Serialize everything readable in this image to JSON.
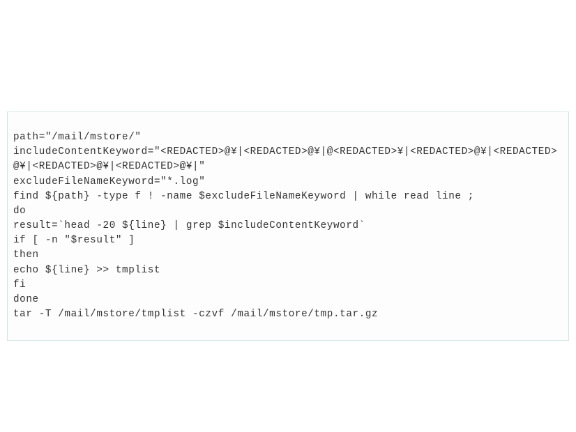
{
  "code": {
    "lines": [
      "path=\"/mail/mstore/\"",
      "includeContentKeyword=\"<REDACTED>@¥|<REDACTED>@¥|@<REDACTED>¥|<REDACTED>@¥|<REDACTED>@¥|<REDACTED>@¥|<REDACTED>@¥|\"",
      "excludeFileNameKeyword=\"*.log\"",
      "find ${path} -type f ! -name $excludeFileNameKeyword | while read line ;",
      "do",
      "result=`head -20 ${line} | grep $includeContentKeyword`",
      "if [ -n \"$result\" ]",
      "then",
      "echo ${line} >> tmplist",
      "fi",
      "done",
      "tar -T /mail/mstore/tmplist -czvf /mail/mstore/tmp.tar.gz"
    ]
  }
}
